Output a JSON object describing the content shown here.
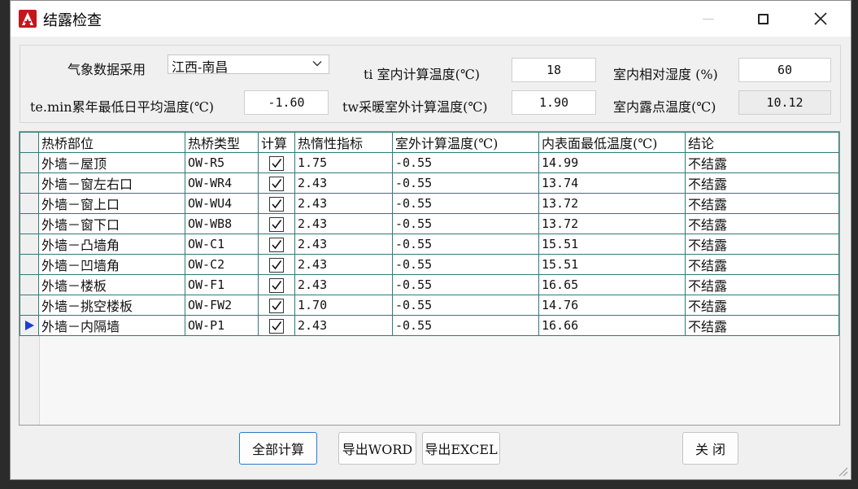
{
  "window": {
    "title": "结露检查"
  },
  "params": {
    "weather_label": "气象数据采用",
    "weather_value": "江西-南昌",
    "ti_label": "ti 室内计算温度(℃)",
    "ti_value": "18",
    "rh_label": "室内相对湿度 (%)",
    "rh_value": "60",
    "temin_label": "te.min累年最低日平均温度(℃)",
    "temin_value": "-1.60",
    "tw_label": "tw采暖室外计算温度(℃)",
    "tw_value": "1.90",
    "dew_label": "室内露点温度(℃)",
    "dew_value": "10.12"
  },
  "table": {
    "headers": [
      "热桥部位",
      "热桥类型",
      "计算",
      "热惰性指标",
      "室外计算温度(℃)",
      "内表面最低温度(℃)",
      "结论"
    ],
    "rows": [
      {
        "part": "外墙－屋顶",
        "type": "OW-R5",
        "checked": true,
        "inertia": "1.75",
        "outdoor": "-0.55",
        "inner_min": "14.99",
        "result": "不结露"
      },
      {
        "part": "外墙－窗左右口",
        "type": "OW-WR4",
        "checked": true,
        "inertia": "2.43",
        "outdoor": "-0.55",
        "inner_min": "13.74",
        "result": "不结露"
      },
      {
        "part": "外墙－窗上口",
        "type": "OW-WU4",
        "checked": true,
        "inertia": "2.43",
        "outdoor": "-0.55",
        "inner_min": "13.72",
        "result": "不结露"
      },
      {
        "part": "外墙－窗下口",
        "type": "OW-WB8",
        "checked": true,
        "inertia": "2.43",
        "outdoor": "-0.55",
        "inner_min": "13.72",
        "result": "不结露"
      },
      {
        "part": "外墙－凸墙角",
        "type": "OW-C1",
        "checked": true,
        "inertia": "2.43",
        "outdoor": "-0.55",
        "inner_min": "15.51",
        "result": "不结露"
      },
      {
        "part": "外墙－凹墙角",
        "type": "OW-C2",
        "checked": true,
        "inertia": "2.43",
        "outdoor": "-0.55",
        "inner_min": "15.51",
        "result": "不结露"
      },
      {
        "part": "外墙－楼板",
        "type": "OW-F1",
        "checked": true,
        "inertia": "2.43",
        "outdoor": "-0.55",
        "inner_min": "16.65",
        "result": "不结露"
      },
      {
        "part": "外墙－挑空楼板",
        "type": "OW-FW2",
        "checked": true,
        "inertia": "1.70",
        "outdoor": "-0.55",
        "inner_min": "14.76",
        "result": "不结露"
      },
      {
        "part": "外墙－内隔墙",
        "type": "OW-P1",
        "checked": true,
        "inertia": "2.43",
        "outdoor": "-0.55",
        "inner_min": "16.66",
        "result": "不结露"
      }
    ],
    "current_row": 8
  },
  "buttons": {
    "calc_all": "全部计算",
    "export_word": "导出WORD",
    "export_excel": "导出EXCEL",
    "close": "关 闭"
  },
  "colors": {
    "accent": "#2f79c8",
    "grid_line": "#2d7b7b",
    "row_pointer": "#1a3fd6"
  }
}
